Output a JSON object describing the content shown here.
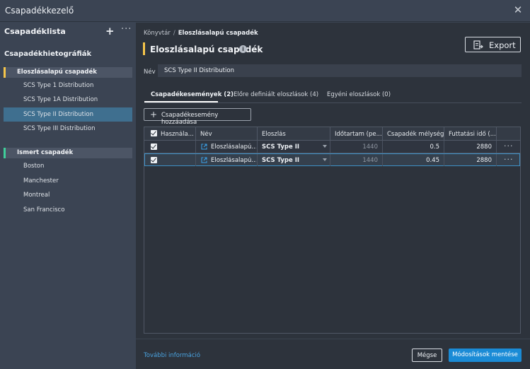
{
  "window": {
    "title": "Csapadékkezelő"
  },
  "sidebar": {
    "header": "Csapadéklista",
    "subheader": "Csapadékhietográfiák",
    "groups": [
      {
        "label": "Eloszlásalapú csapadék",
        "color": "#f5c54a",
        "items": [
          {
            "label": "SCS Type 1 Distribution"
          },
          {
            "label": "SCS Type 1A Distribution"
          },
          {
            "label": "SCS Type II Distribution",
            "selected": true
          },
          {
            "label": "SCS Type III Distribution"
          }
        ]
      },
      {
        "label": "Ismert csapadék",
        "color": "#3fcf9a",
        "items": [
          {
            "label": "Boston"
          },
          {
            "label": "Manchester"
          },
          {
            "label": "Montreal"
          },
          {
            "label": "San Francisco"
          }
        ]
      }
    ]
  },
  "main": {
    "breadcrumb": {
      "root": "Könyvtár",
      "separator": "/",
      "current": "Eloszlásalapú csapadék"
    },
    "title": "Eloszlásalapú csapadék",
    "info_icon": "info-icon",
    "export_label": "Export",
    "name_label": "Név",
    "name_value": "SCS Type II Distribution",
    "tabs": [
      {
        "label": "Csapadékesemények (2)",
        "active": true
      },
      {
        "label": "Előre definiált eloszlások (4)"
      },
      {
        "label": "Egyéni eloszlások (0)"
      }
    ],
    "add_button": "Csapadékesemény hozzáadása",
    "table": {
      "headers": [
        "Használa...",
        "Név",
        "Eloszlás",
        "Időtartam (pe...",
        "Csapadék mélység...",
        "Futtatási idő (...",
        ""
      ],
      "rows": [
        {
          "name": "Eloszlásalapú...",
          "distribution": "SCS Type II",
          "duration": "1440",
          "depth": "0.5",
          "runtime": "2880"
        },
        {
          "name": "Eloszlásalapú...",
          "distribution": "SCS Type II",
          "duration": "1440",
          "depth": "0.45",
          "runtime": "2880"
        }
      ]
    },
    "footer": {
      "more_info": "További információ",
      "cancel": "Mégse",
      "save": "Módosítások mentése"
    }
  },
  "colors": {
    "accent": "#1a8bd6",
    "selection": "#3f6f8f",
    "distribution_group": "#f5c54a",
    "known_group": "#3fcf9a"
  }
}
